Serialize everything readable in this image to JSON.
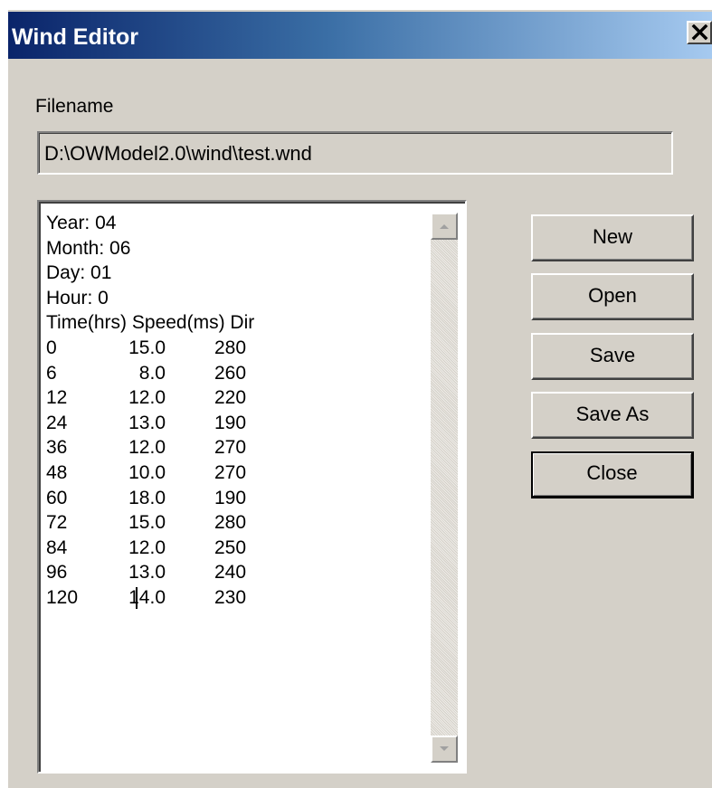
{
  "window": {
    "title": "Wind Editor",
    "close_glyph": "close-icon"
  },
  "filename": {
    "label": "Filename",
    "value": "D:\\OWModel2.0\\wind\\test.wnd"
  },
  "editor": {
    "header_lines": [
      "Year: 04",
      "Month: 06",
      "Day: 01",
      "Hour: 0",
      "Time(hrs) Speed(ms) Dir"
    ],
    "rows": [
      {
        "time": "0",
        "speed": "15.0",
        "dir": "280"
      },
      {
        "time": "6",
        "speed": "8.0",
        "dir": "260"
      },
      {
        "time": "12",
        "speed": "12.0",
        "dir": "220"
      },
      {
        "time": "24",
        "speed": "13.0",
        "dir": "190"
      },
      {
        "time": "36",
        "speed": "12.0",
        "dir": "270"
      },
      {
        "time": "48",
        "speed": "10.0",
        "dir": "270"
      },
      {
        "time": "60",
        "speed": "18.0",
        "dir": "190"
      },
      {
        "time": "72",
        "speed": "15.0",
        "dir": "280"
      },
      {
        "time": "84",
        "speed": "12.0",
        "dir": "250"
      },
      {
        "time": "96",
        "speed": "13.0",
        "dir": "240"
      },
      {
        "time": "120",
        "speed": "14.0",
        "dir": "230"
      }
    ]
  },
  "buttons": {
    "new": "New",
    "open": "Open",
    "save": "Save",
    "save_as": "Save As",
    "close": "Close"
  },
  "colors": {
    "face": "#d4d0c8",
    "title_start": "#0a246a",
    "title_end": "#a6caf0"
  }
}
